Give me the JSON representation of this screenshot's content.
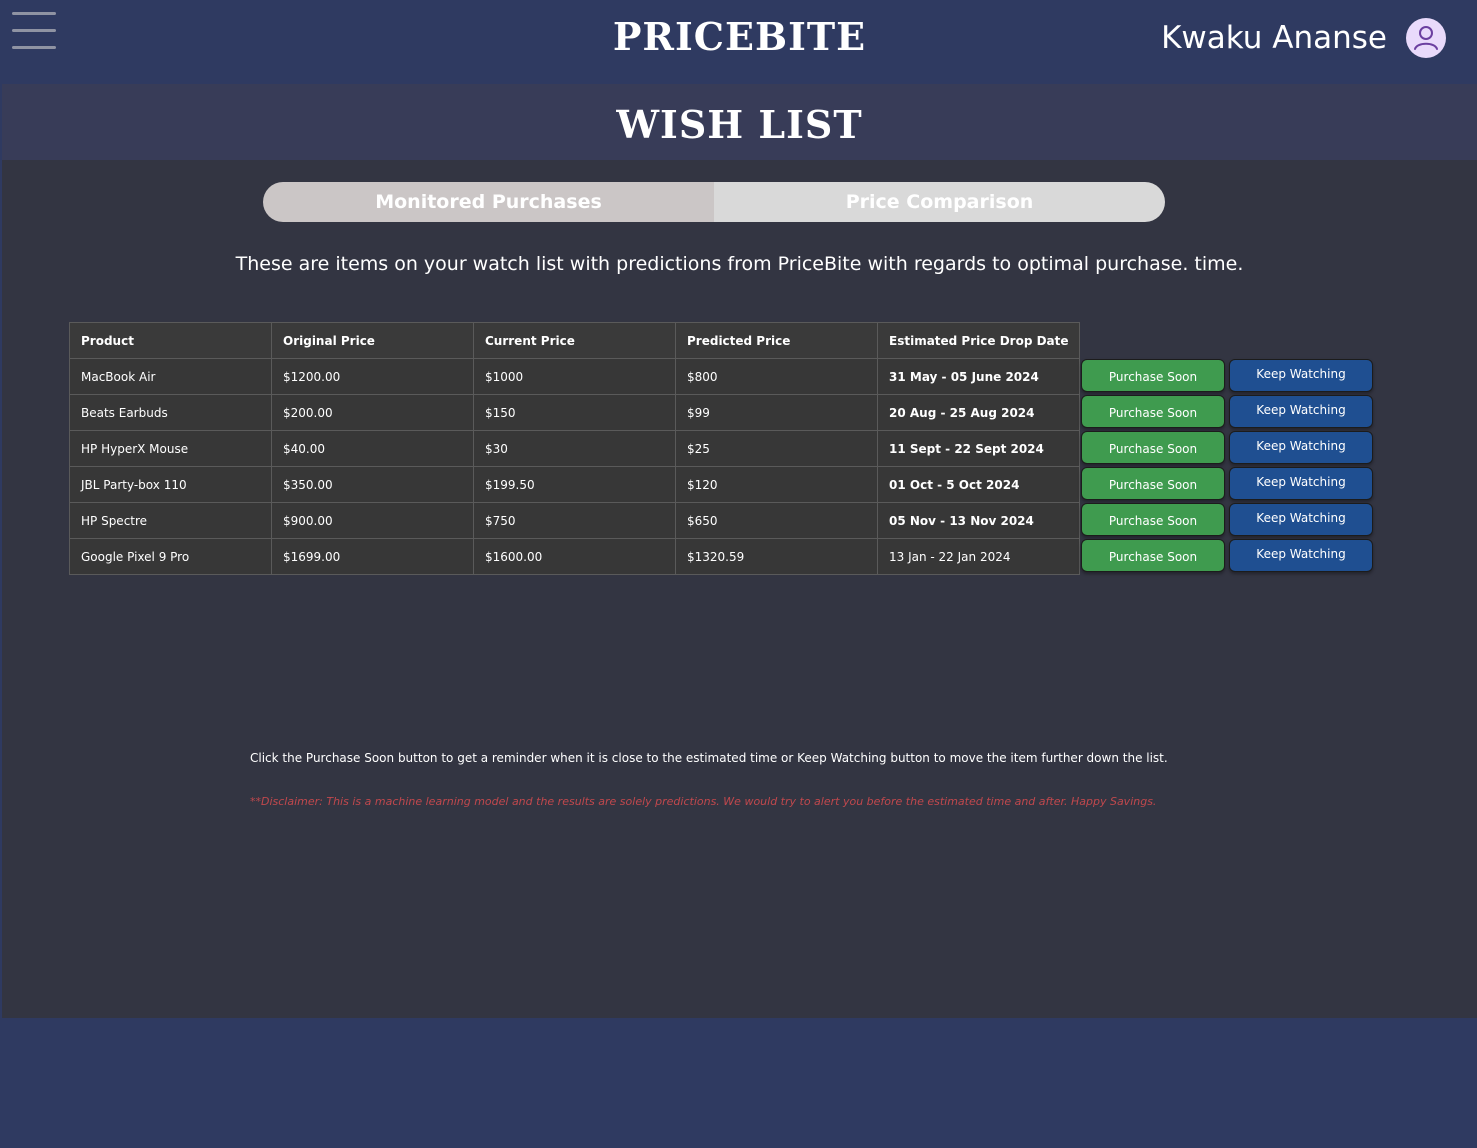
{
  "header": {
    "brand": "PRICEBITE",
    "user_name": "Kwaku Ananse",
    "menu_icon": "hamburger-menu-icon",
    "avatar_icon": "user-avatar-icon"
  },
  "page": {
    "title": "WISH LIST"
  },
  "tabs": [
    {
      "label": "Monitored Purchases",
      "active": true
    },
    {
      "label": "Price Comparison",
      "active": false
    }
  ],
  "intro_text": "These are items on your watch list with predictions from PriceBite with regards to optimal purchase. time.",
  "table": {
    "columns": [
      "Product",
      "Original Price",
      "Current Price",
      "Predicted Price",
      "Estimated Price Drop Date"
    ],
    "rows": [
      [
        "MacBook Air",
        "$1200.00",
        "$1000",
        "$800",
        "31 May - 05 June 2024"
      ],
      [
        "Beats Earbuds",
        "$200.00",
        "$150",
        "$99",
        "20 Aug - 25 Aug 2024"
      ],
      [
        "HP HyperX Mouse",
        "$40.00",
        "$30",
        "$25",
        "11 Sept - 22 Sept 2024"
      ],
      [
        "JBL Party-box 110",
        "$350.00",
        "$199.50",
        "$120",
        "01 Oct - 5 Oct 2024"
      ],
      [
        "HP Spectre",
        "$900.00",
        "$750",
        "$650",
        "05 Nov - 13 Nov 2024"
      ],
      [
        "Google Pixel 9 Pro",
        "$1699.00",
        "$1600.00",
        "$1320.59",
        "13 Jan - 22 Jan 2024"
      ]
    ]
  },
  "actions": {
    "purchase_label": "Purchase Soon",
    "watch_label": "Keep Watching"
  },
  "note": "Click the Purchase Soon button to get a reminder when it is close to the estimated time or Keep Watching button to move the item further down the list.",
  "disclaimer": "**Disclaimer: This is a machine learning model and the results are solely predictions. We would try to alert you before the estimated time and after. Happy Savings.",
  "colors": {
    "header_bg": "#2f3a61",
    "title_band_bg": "#383c58",
    "content_bg": "#333542",
    "purchase_green": "#3f9b4f",
    "watch_blue": "#1f4f91",
    "disclaimer_red": "#c0484d",
    "avatar_bg": "#e9dafb"
  }
}
